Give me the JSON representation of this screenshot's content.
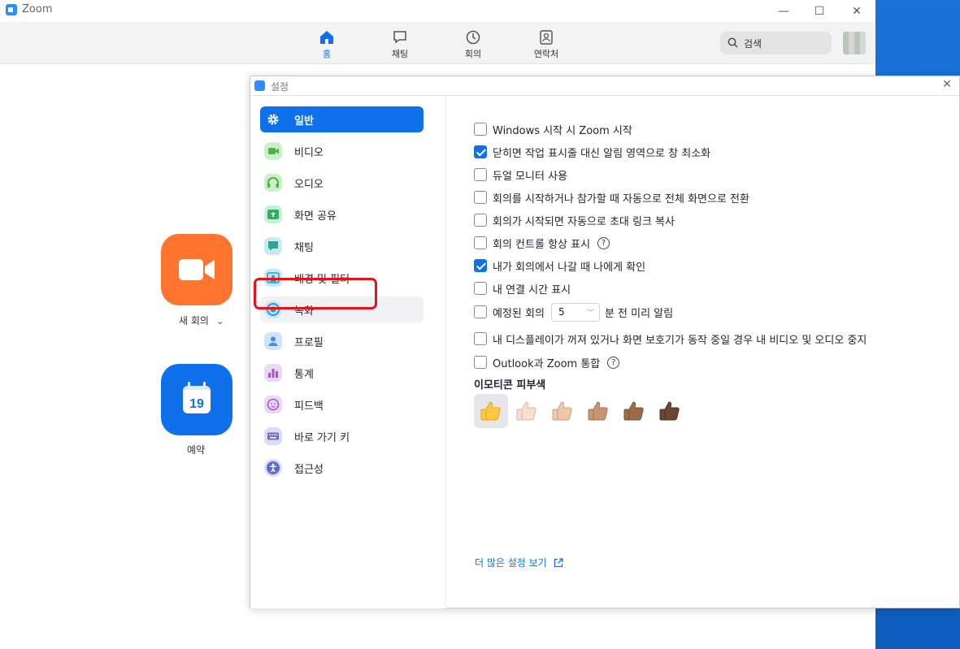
{
  "window": {
    "title": "Zoom",
    "minimize": "—",
    "maximize": "☐",
    "close": "✕"
  },
  "nav": {
    "tabs": [
      {
        "label": "홈",
        "icon": "home-icon",
        "active": true
      },
      {
        "label": "채팅",
        "icon": "chat-icon",
        "active": false
      },
      {
        "label": "회의",
        "icon": "clock-icon",
        "active": false
      },
      {
        "label": "연락처",
        "icon": "contacts-icon",
        "active": false
      }
    ],
    "search_placeholder": "검색"
  },
  "home": {
    "new_meeting_label": "새 회의",
    "new_meeting_chevron": "⌄",
    "schedule_label": "예약",
    "calendar_day": "19"
  },
  "settings": {
    "title": "설정",
    "close": "✕",
    "sidebar": [
      {
        "label": "일반",
        "icon": "gear-icon",
        "color": "#ffffff",
        "active": true
      },
      {
        "label": "비디오",
        "icon": "video-icon",
        "color": "#72c36b"
      },
      {
        "label": "오디오",
        "icon": "headphones-icon",
        "color": "#72c36b"
      },
      {
        "label": "화면 공유",
        "icon": "share-screen-icon",
        "color": "#3ebf6f"
      },
      {
        "label": "채팅",
        "icon": "chat-icon",
        "color": "#3fb8b0"
      },
      {
        "label": "배경 및 필터",
        "icon": "background-icon",
        "color": "#36b2dc"
      },
      {
        "label": "녹화",
        "icon": "record-icon",
        "color": "#3aaee6"
      },
      {
        "label": "프로필",
        "icon": "profile-icon",
        "color": "#4b9ff0"
      },
      {
        "label": "통계",
        "icon": "statistics-icon",
        "color": "#a96cd0"
      },
      {
        "label": "피드백",
        "icon": "feedback-icon",
        "color": "#a96cd0"
      },
      {
        "label": "바로 가기 키",
        "icon": "keyboard-icon",
        "color": "#7e7ad6"
      },
      {
        "label": "접근성",
        "icon": "accessibility-icon",
        "color": "#6f79d3"
      }
    ],
    "options": [
      {
        "label": "Windows 시작 시 Zoom 시작",
        "checked": false
      },
      {
        "label": "닫히면 작업 표시줄 대신 알림 영역으로 창 최소화",
        "checked": true
      },
      {
        "label": "듀얼 모니터 사용",
        "checked": false
      },
      {
        "label": "회의를 시작하거나 참가할 때 자동으로 전체 화면으로 전환",
        "checked": false
      },
      {
        "label": "회의가 시작되면 자동으로 초대 링크 복사",
        "checked": false
      },
      {
        "label": "회의 컨트롤 항상 표시",
        "checked": false,
        "help": "?"
      },
      {
        "label": "내가 회의에서 나갈 때 나에게 확인",
        "checked": true
      },
      {
        "label": "내 연결 시간 표시",
        "checked": false
      },
      {
        "label": "예정된 회의",
        "checked": false,
        "select_value": "5",
        "suffix": "분 전 미리 알림"
      },
      {
        "label": "내 디스플레이가 꺼져 있거나 화면 보호기가 동작 중일 경우 내 비디오 및 오디오 중지",
        "checked": false
      },
      {
        "label": "Outlook과 Zoom 통합",
        "checked": false,
        "help": "?"
      }
    ],
    "skin_tone_title": "이모티콘 피부색",
    "skin_tones": [
      {
        "emoji": "👍",
        "color": "#ffc83d",
        "selected": true
      },
      {
        "emoji": "👍🏻",
        "color": "#f7dece"
      },
      {
        "emoji": "👍🏼",
        "color": "#f3d2a2"
      },
      {
        "emoji": "👍🏽",
        "color": "#d5ab88"
      },
      {
        "emoji": "👍🏾",
        "color": "#af7e57"
      },
      {
        "emoji": "👍🏿",
        "color": "#7c533e"
      }
    ],
    "more_settings_link": "더 많은 설정 보기"
  },
  "accent_color": "#0e71eb",
  "highlight_color": "#e8121b"
}
